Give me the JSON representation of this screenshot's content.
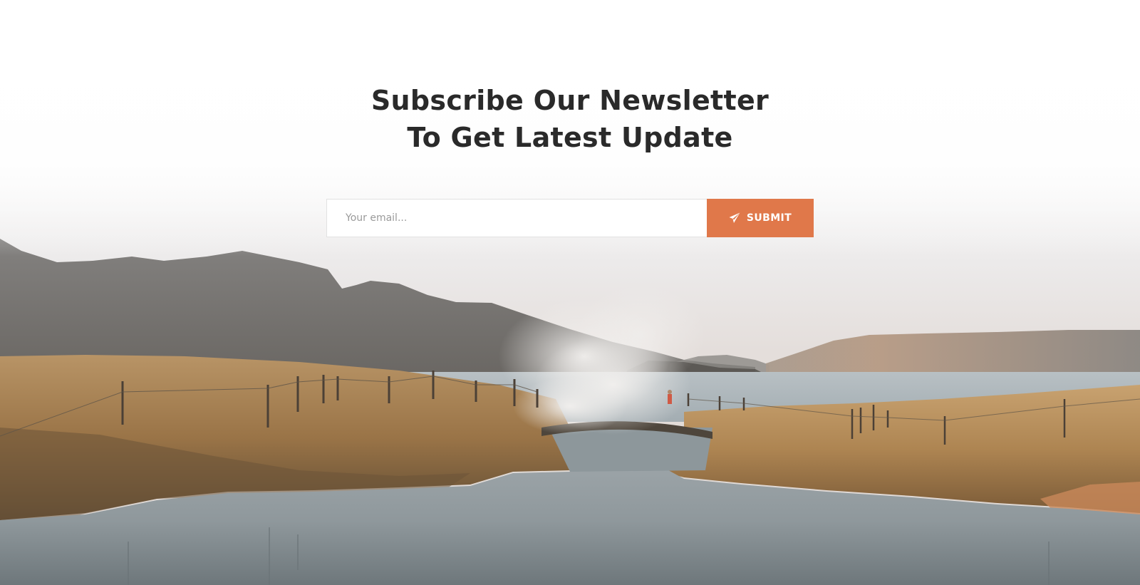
{
  "newsletter": {
    "title_line1": "Subscribe Our Newsletter",
    "title_line2": "To Get Latest Update",
    "email_placeholder": "Your email...",
    "submit_label": "SUBMIT",
    "submit_icon": "paper-plane-icon"
  },
  "colors": {
    "accent": "#e0784a",
    "title": "#2a2a2a",
    "background": "#ffffff"
  }
}
